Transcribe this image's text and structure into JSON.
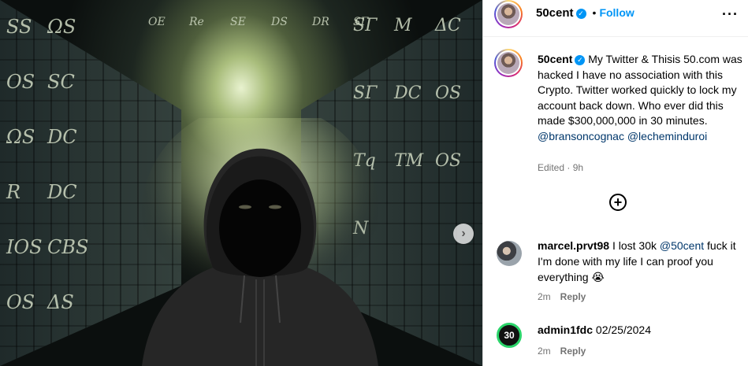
{
  "post": {
    "username": "50cent",
    "follow_label": "Follow",
    "separator": "•",
    "more_label": "···",
    "caption": {
      "username": "50cent",
      "text": "My Twitter & Thisis 50.com was hacked I have no association with this Crypto. Twitter worked quickly to lock my account back down. Who ever did this made $300,000,000 in 30 minutes.",
      "mentions": [
        "@bransoncognac",
        "@lecheminduroi"
      ],
      "meta": "Edited · 9h"
    }
  },
  "media": {
    "next_icon": "chevron-right-icon",
    "next_glyph": "›",
    "left_glyphs": [
      "SS",
      "ΩS",
      "OS",
      "SC",
      "ΩS",
      "DC",
      "R",
      "DC",
      "ΙOS",
      "CBS",
      "OS",
      "ΔS"
    ],
    "right_glyphs": [
      "SΓ",
      "M",
      "ΔC",
      "SΓ",
      "DC",
      "OS",
      "Tq",
      "TM",
      "OS",
      "N"
    ],
    "center_glyphs": [
      "OE",
      "Re",
      "SE",
      "DS",
      "DR",
      "SΓ"
    ]
  },
  "add_comment_icon": "plus-circle-icon",
  "add_comment_glyph": "+",
  "comments": [
    {
      "username": "marcel.prvt98",
      "text_before": "I lost 30k ",
      "mention": "@50cent",
      "text_after": " fuck it I'm done with my life I can proof you everything 😭",
      "age": "2m",
      "reply_label": "Reply"
    },
    {
      "username": "admin1fdc",
      "text": "02/25/2024",
      "avatar_label": "30",
      "age": "2m",
      "reply_label": "Reply"
    }
  ],
  "colors": {
    "accent": "#0095f6",
    "mention": "#00376b",
    "muted": "#737373"
  }
}
